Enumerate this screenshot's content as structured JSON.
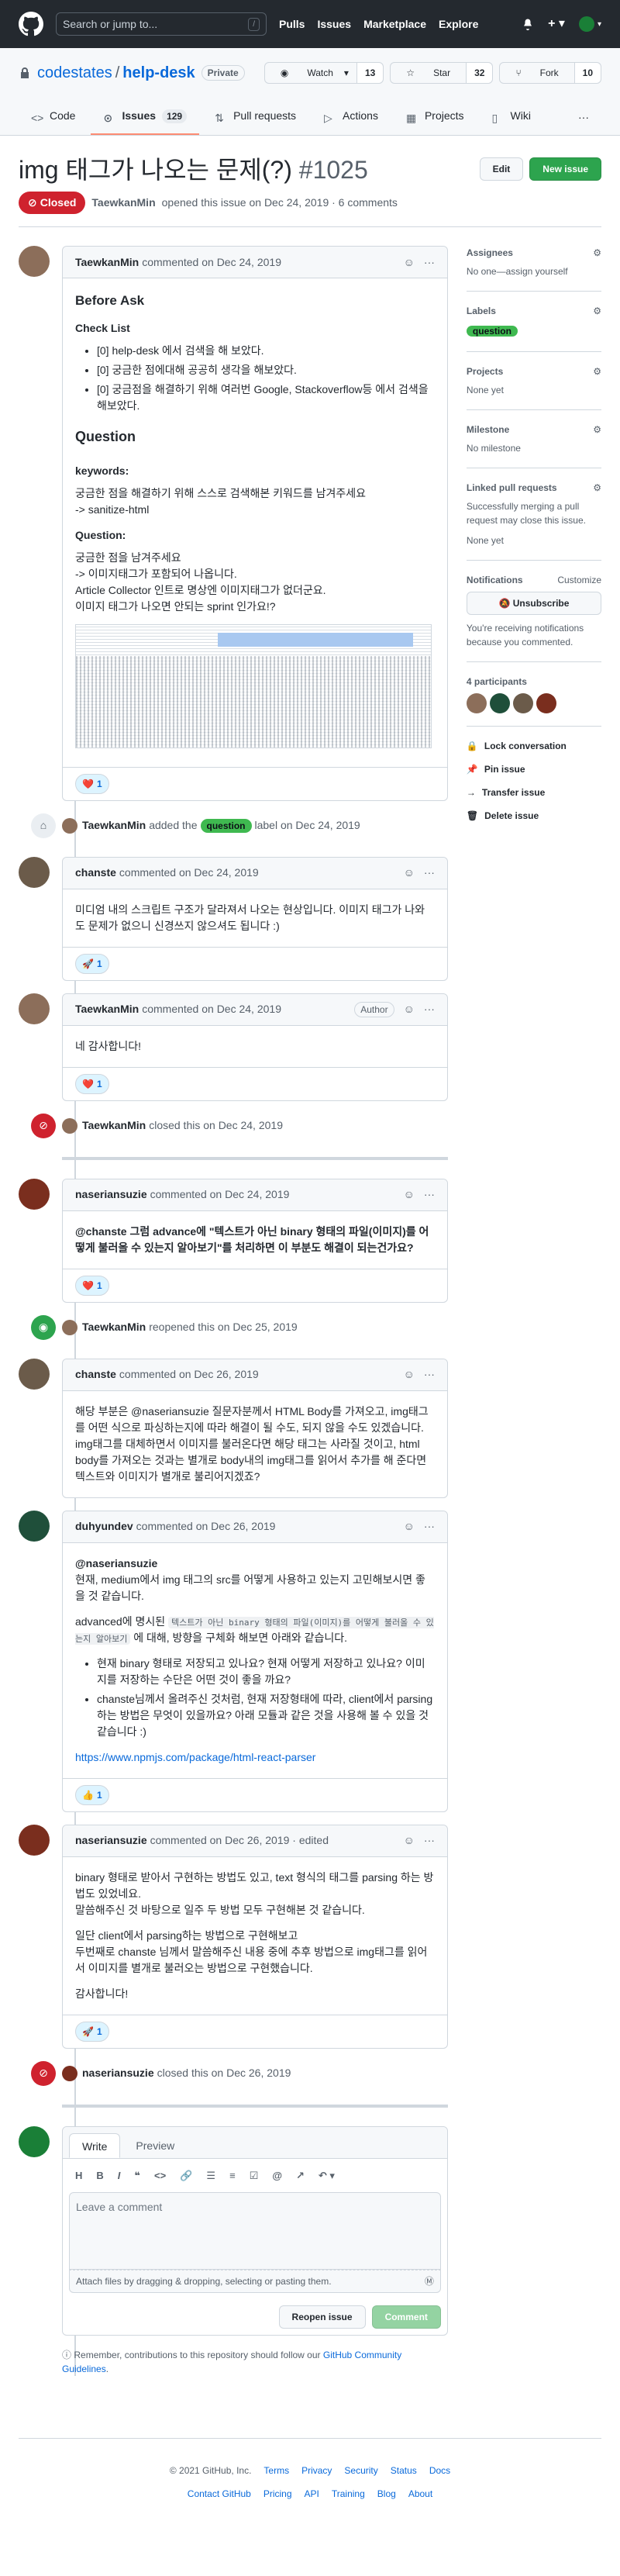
{
  "header": {
    "search_placeholder": "Search or jump to...",
    "search_key": "/",
    "nav": [
      "Pulls",
      "Issues",
      "Marketplace",
      "Explore"
    ]
  },
  "repo": {
    "owner": "codestates",
    "name": "help-desk",
    "visibility": "Private",
    "watch": "Watch",
    "watch_count": "13",
    "star": "Star",
    "star_count": "32",
    "fork": "Fork",
    "fork_count": "10",
    "tabs": [
      {
        "label": "Code"
      },
      {
        "label": "Issues",
        "count": "129"
      },
      {
        "label": "Pull requests"
      },
      {
        "label": "Actions"
      },
      {
        "label": "Projects"
      },
      {
        "label": "Wiki"
      }
    ]
  },
  "issue": {
    "title": "img 태그가 나오는 문제(?)",
    "number": "#1025",
    "edit": "Edit",
    "new_issue": "New issue",
    "state": "Closed",
    "author": "TaewkanMin",
    "meta": "opened this issue on Dec 24, 2019 · 6 comments"
  },
  "comments": {
    "c1": {
      "author": "TaewkanMin",
      "time": "commented on Dec 24, 2019",
      "h_before": "Before Ask",
      "h_check": "Check List",
      "checks": [
        "[0] help-desk 에서 검색을 해 보았다.",
        "[0] 궁금한 점에대해 공공히 생각을 해보았다.",
        "[0] 궁금점을 해결하기 위해 여러번 Google, Stackoverflow등 에서 검색을 해보았다."
      ],
      "h_question": "Question",
      "h_keywords": "keywords:",
      "kw1": "궁금한 점을 해결하기 위해 스스로 검색해본 키워드를 남겨주세요",
      "kw2": "-> sanitize-html",
      "h_q2": "Question:",
      "q1": "궁금한 점을 남겨주세요",
      "q2": "-> 이미지태그가 포함되어 나옵니다.",
      "q3": "Article Collector 인트로 명상엔 이미지태그가 없더군요.",
      "q4": "이미지 태그가 나오면 안되는 sprint 인가요!?",
      "reaction": "1"
    },
    "e1": {
      "who": "TaewkanMin",
      "pre": "added the",
      "label": "question",
      "post": "label on Dec 24, 2019"
    },
    "c2": {
      "author": "chanste",
      "time": "commented on Dec 24, 2019",
      "body": "미디엄 내의 스크립트 구조가 달라져서 나오는 현상입니다. 이미지 태그가 나와도 문제가 없으니 신경쓰지 않으셔도 됩니다 :)",
      "reaction": "1"
    },
    "c3": {
      "author": "TaewkanMin",
      "time": "commented on Dec 24, 2019",
      "role": "Author",
      "body": "네 감사합니다!",
      "reaction": "1"
    },
    "e2": {
      "who": "TaewkanMin",
      "text": "closed this on Dec 24, 2019"
    },
    "c4": {
      "author": "naseriansuzie",
      "time": "commented on Dec 24, 2019",
      "body": "@chanste 그럼 advance에 \"텍스트가 아닌 binary 형태의 파일(이미지)를 어떻게 불러올 수 있는지 알아보기\"를 처리하면 이 부분도 해결이 되는건가요?",
      "reaction": "1"
    },
    "e3": {
      "who": "TaewkanMin",
      "text": "reopened this on Dec 25, 2019"
    },
    "c5": {
      "author": "chanste",
      "time": "commented on Dec 26, 2019",
      "body": "해당 부분은 @naseriansuzie 질문자분께서 HTML Body를 가져오고, img태그를 어떤 식으로 파싱하는지에 따라 해결이 될 수도, 되지 않을 수도 있겠습니다. img태그를 대체하면서 이미지를 불러온다면 해당 태그는 사라질 것이고, html body를 가져오는 것과는 별개로 body내의 img태그를 읽어서 추가를 해 준다면 텍스트와 이미지가 별개로 불리어지겠죠?"
    },
    "c6": {
      "author": "duhyundev",
      "time": "commented on Dec 26, 2019",
      "mention": "@naseriansuzie",
      "p1": "현재, medium에서 img 태그의 src를 어떻게 사용하고 있는지 고민해보시면 좋을 것 같습니다.",
      "p2a": "advanced에 명시된",
      "p2code": "텍스트가 아닌 binary 형태의 파일(이미지)를 어떻게 불러올 수 있는지 알아보기",
      "p2b": "에 대해, 방향을 구체화 해보면 아래와 같습니다.",
      "li1": "현재 binary 형태로 저장되고 있나요? 현재 어떻게 저장하고 있나요? 이미지를 저장하는 수단은 어떤 것이 좋을 까요?",
      "li2": "chanste님께서 올려주신 것처럼, 현재 저장형태에 따라, client에서 parsing하는 방법은 무엇이 있을까요? 아래 모듈과 같은 것을 사용해 볼 수 있을 것 같습니다 :)",
      "link": "https://www.npmjs.com/package/html-react-parser",
      "reaction": "1"
    },
    "c7": {
      "author": "naseriansuzie",
      "time": "commented on Dec 26, 2019 · edited",
      "p1": "binary 형태로 받아서 구현하는 방법도 있고, text 형식의 태그를 parsing 하는 방법도 있었네요.",
      "p2": "말씀해주신 것 바탕으로 일주 두 방법 모두 구현해본 것 같습니다.",
      "p3": "일단 client에서 parsing하는 방법으로 구현해보고",
      "p4": "두번째로 chanste 님께서 말씀해주신 내용 중에 추후 방법으로 img태그를 읽어서 이미지를 별개로 불러오는 방법으로 구현했습니다.",
      "p5": "감사합니다!",
      "reaction": "1"
    },
    "e4": {
      "who": "naseriansuzie",
      "text": "closed this on Dec 26, 2019"
    }
  },
  "editor": {
    "write": "Write",
    "preview": "Preview",
    "placeholder": "Leave a comment",
    "attach": "Attach files by dragging & dropping, selecting or pasting them.",
    "reopen": "Reopen issue",
    "comment": "Comment",
    "tip_pre": "Remember, contributions to this repository should follow our",
    "tip_link": "GitHub Community Guidelines",
    "tip_post": "."
  },
  "sidebar": {
    "assignees": "Assignees",
    "assignees_val": "No one—assign yourself",
    "labels": "Labels",
    "label_val": "question",
    "projects": "Projects",
    "projects_val": "None yet",
    "milestone": "Milestone",
    "milestone_val": "No milestone",
    "linked": "Linked pull requests",
    "linked_desc": "Successfully merging a pull request may close this issue.",
    "linked_val": "None yet",
    "notifications": "Notifications",
    "customize": "Customize",
    "unsubscribe": "Unsubscribe",
    "notif_desc": "You're receiving notifications because you commented.",
    "participants": "4 participants",
    "lock": "Lock conversation",
    "pin": "Pin issue",
    "transfer": "Transfer issue",
    "delete": "Delete issue"
  },
  "footer": {
    "copy": "© 2021 GitHub, Inc.",
    "links1": [
      "Terms",
      "Privacy",
      "Security",
      "Status",
      "Docs"
    ],
    "links2": [
      "Contact GitHub",
      "Pricing",
      "API",
      "Training",
      "Blog",
      "About"
    ]
  },
  "colors": {
    "header_bg": "#24292f",
    "closed": "#cf222e",
    "green": "#2da44e",
    "link": "#0969da",
    "label": "#3fb950"
  }
}
